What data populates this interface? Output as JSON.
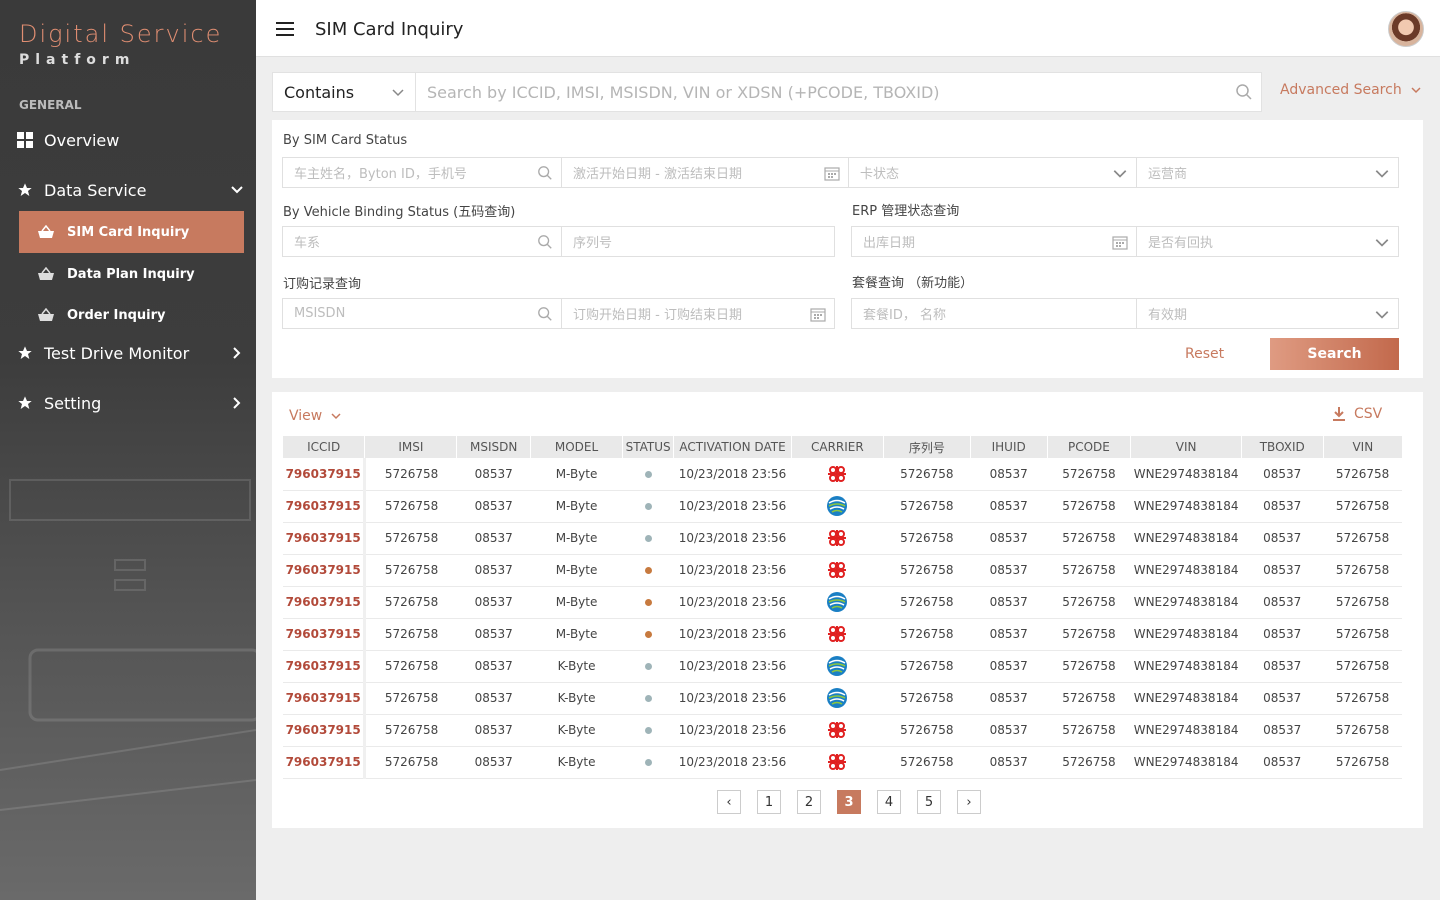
{
  "sidebar": {
    "brand_title": "Digital Service",
    "brand_subtitle": "Platform",
    "section_label": "GENERAL",
    "items": [
      {
        "label": "Overview",
        "icon": "grid-icon"
      },
      {
        "label": "Data Service",
        "icon": "star-icon",
        "expanded": true
      },
      {
        "label": "Test Drive Monitor",
        "icon": "star-icon"
      },
      {
        "label": "Setting",
        "icon": "star-icon"
      }
    ],
    "sub_items": [
      {
        "label": "SIM Card Inquiry",
        "active": true
      },
      {
        "label": "Data Plan Inquiry",
        "active": false
      },
      {
        "label": "Order Inquiry",
        "active": false
      }
    ]
  },
  "header": {
    "title": "SIM Card Inquiry"
  },
  "search": {
    "mode": "Contains",
    "placeholder": "Search by ICCID, IMSI, MSISDN, VIN or XDSN (+PCODE, TBOXID)",
    "advanced_label": "Advanced Search"
  },
  "filters": {
    "sim_status_label": "By SIM Card Status",
    "owner_placeholder": "车主姓名，Byton ID，手机号",
    "activation_date_placeholder": "激活开始日期 - 激活结束日期",
    "card_status_placeholder": "卡状态",
    "carrier_placeholder": "运营商",
    "vehicle_binding_label": "By Vehicle Binding Status (五码查询)",
    "series_placeholder": "车系",
    "serial_placeholder": "序列号",
    "erp_label": "ERP 管理状态查询",
    "outbound_date_placeholder": "出库日期",
    "receipt_placeholder": "是否有回执",
    "order_label": "订购记录查询",
    "msisdn_placeholder": "MSISDN",
    "order_date_placeholder": "订购开始日期 - 订购结束日期",
    "plan_label": "套餐查询 （新功能）",
    "plan_id_placeholder": "套餐ID， 名称",
    "validity_placeholder": "有效期",
    "reset_label": "Reset",
    "search_label": "Search"
  },
  "results": {
    "view_label": "View",
    "csv_label": "CSV",
    "columns": [
      "ICCID",
      "IMSI",
      "MSISDN",
      "MODEL",
      "STATUS",
      "ACTIVATION DATE",
      "CARRIER",
      "序列号",
      "IHUID",
      "PCODE",
      "VIN",
      "TBOXID",
      "VIN"
    ],
    "rows": [
      {
        "iccid": "796037915",
        "imsi": "5726758",
        "msisdn": "08537",
        "model": "M-Byte",
        "status": "gray",
        "date": "10/23/2018 23:56",
        "carrier": "unicom",
        "serial": "5726758",
        "ihuid": "08537",
        "pcode": "5726758",
        "vin": "WNE2974838184",
        "tboxid": "08537",
        "vin2": "5726758"
      },
      {
        "iccid": "796037915",
        "imsi": "5726758",
        "msisdn": "08537",
        "model": "M-Byte",
        "status": "gray",
        "date": "10/23/2018 23:56",
        "carrier": "mobile",
        "serial": "5726758",
        "ihuid": "08537",
        "pcode": "5726758",
        "vin": "WNE2974838184",
        "tboxid": "08537",
        "vin2": "5726758"
      },
      {
        "iccid": "796037915",
        "imsi": "5726758",
        "msisdn": "08537",
        "model": "M-Byte",
        "status": "gray",
        "date": "10/23/2018 23:56",
        "carrier": "unicom",
        "serial": "5726758",
        "ihuid": "08537",
        "pcode": "5726758",
        "vin": "WNE2974838184",
        "tboxid": "08537",
        "vin2": "5726758"
      },
      {
        "iccid": "796037915",
        "imsi": "5726758",
        "msisdn": "08537",
        "model": "M-Byte",
        "status": "orange",
        "date": "10/23/2018 23:56",
        "carrier": "unicom",
        "serial": "5726758",
        "ihuid": "08537",
        "pcode": "5726758",
        "vin": "WNE2974838184",
        "tboxid": "08537",
        "vin2": "5726758"
      },
      {
        "iccid": "796037915",
        "imsi": "5726758",
        "msisdn": "08537",
        "model": "M-Byte",
        "status": "orange",
        "date": "10/23/2018 23:56",
        "carrier": "mobile",
        "serial": "5726758",
        "ihuid": "08537",
        "pcode": "5726758",
        "vin": "WNE2974838184",
        "tboxid": "08537",
        "vin2": "5726758"
      },
      {
        "iccid": "796037915",
        "imsi": "5726758",
        "msisdn": "08537",
        "model": "M-Byte",
        "status": "orange",
        "date": "10/23/2018 23:56",
        "carrier": "unicom",
        "serial": "5726758",
        "ihuid": "08537",
        "pcode": "5726758",
        "vin": "WNE2974838184",
        "tboxid": "08537",
        "vin2": "5726758"
      },
      {
        "iccid": "796037915",
        "imsi": "5726758",
        "msisdn": "08537",
        "model": "K-Byte",
        "status": "gray",
        "date": "10/23/2018 23:56",
        "carrier": "mobile",
        "serial": "5726758",
        "ihuid": "08537",
        "pcode": "5726758",
        "vin": "WNE2974838184",
        "tboxid": "08537",
        "vin2": "5726758"
      },
      {
        "iccid": "796037915",
        "imsi": "5726758",
        "msisdn": "08537",
        "model": "K-Byte",
        "status": "gray",
        "date": "10/23/2018 23:56",
        "carrier": "mobile",
        "serial": "5726758",
        "ihuid": "08537",
        "pcode": "5726758",
        "vin": "WNE2974838184",
        "tboxid": "08537",
        "vin2": "5726758"
      },
      {
        "iccid": "796037915",
        "imsi": "5726758",
        "msisdn": "08537",
        "model": "K-Byte",
        "status": "gray",
        "date": "10/23/2018 23:56",
        "carrier": "unicom",
        "serial": "5726758",
        "ihuid": "08537",
        "pcode": "5726758",
        "vin": "WNE2974838184",
        "tboxid": "08537",
        "vin2": "5726758"
      },
      {
        "iccid": "796037915",
        "imsi": "5726758",
        "msisdn": "08537",
        "model": "K-Byte",
        "status": "gray",
        "date": "10/23/2018 23:56",
        "carrier": "unicom",
        "serial": "5726758",
        "ihuid": "08537",
        "pcode": "5726758",
        "vin": "WNE2974838184",
        "tboxid": "08537",
        "vin2": "5726758"
      }
    ],
    "pagination": {
      "pages": [
        "1",
        "2",
        "3",
        "4",
        "5"
      ],
      "current": "3",
      "prev_label": "‹",
      "next_label": "›"
    }
  },
  "colors": {
    "accent": "#c77a5f",
    "iccid": "#b24a3a",
    "status_gray": "#9fb4b8",
    "status_orange": "#c77a3f",
    "unicom": "#e02020",
    "mobile_blue": "#1a7fc4",
    "mobile_green": "#8cc63f"
  }
}
